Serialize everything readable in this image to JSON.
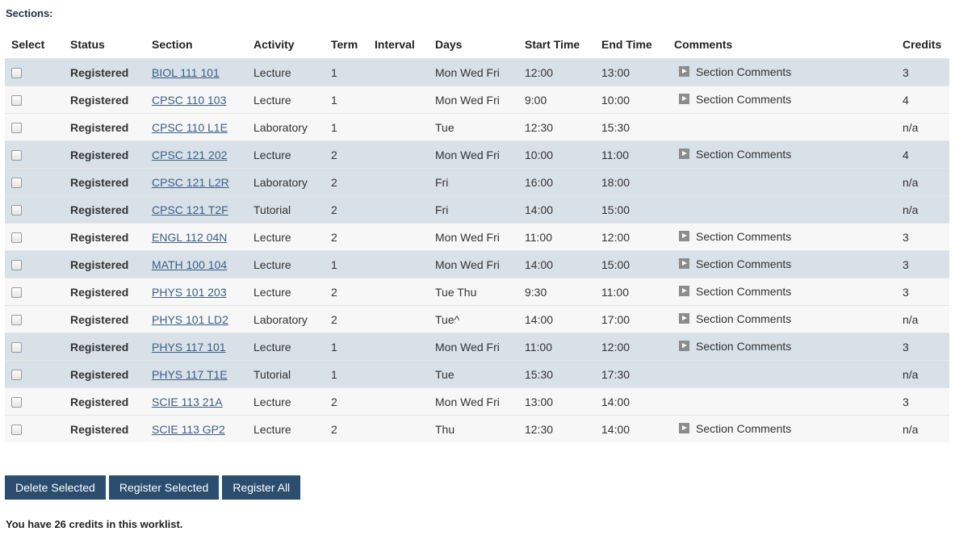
{
  "sections_label": "Sections:",
  "columns": [
    "Select",
    "Status",
    "Section",
    "Activity",
    "Term",
    "Interval",
    "Days",
    "Start Time",
    "End Time",
    "Comments",
    "Credits"
  ],
  "rows": [
    {
      "status": "Registered",
      "section": "BIOL 111 101",
      "activity": "Lecture",
      "term": "1",
      "interval": "",
      "days": "Mon Wed Fri",
      "start": "12:00",
      "end": "13:00",
      "comments": "Section Comments",
      "credits": "3",
      "shade": "shaded"
    },
    {
      "status": "Registered",
      "section": "CPSC 110 103",
      "activity": "Lecture",
      "term": "1",
      "interval": "",
      "days": "Mon Wed Fri",
      "start": "9:00",
      "end": "10:00",
      "comments": "Section Comments",
      "credits": "4",
      "shade": "plain"
    },
    {
      "status": "Registered",
      "section": "CPSC 110 L1E",
      "activity": "Laboratory",
      "term": "1",
      "interval": "",
      "days": "Tue",
      "start": "12:30",
      "end": "15:30",
      "comments": "",
      "credits": "n/a",
      "shade": "plain"
    },
    {
      "status": "Registered",
      "section": "CPSC 121 202",
      "activity": "Lecture",
      "term": "2",
      "interval": "",
      "days": "Mon Wed Fri",
      "start": "10:00",
      "end": "11:00",
      "comments": "Section Comments",
      "credits": "4",
      "shade": "shaded"
    },
    {
      "status": "Registered",
      "section": "CPSC 121 L2R",
      "activity": "Laboratory",
      "term": "2",
      "interval": "",
      "days": "Fri",
      "start": "16:00",
      "end": "18:00",
      "comments": "",
      "credits": "n/a",
      "shade": "shaded"
    },
    {
      "status": "Registered",
      "section": "CPSC 121 T2F",
      "activity": "Tutorial",
      "term": "2",
      "interval": "",
      "days": "Fri",
      "start": "14:00",
      "end": "15:00",
      "comments": "",
      "credits": "n/a",
      "shade": "shaded"
    },
    {
      "status": "Registered",
      "section": "ENGL 112 04N",
      "activity": "Lecture",
      "term": "2",
      "interval": "",
      "days": "Mon Wed Fri",
      "start": "11:00",
      "end": "12:00",
      "comments": "Section Comments",
      "credits": "3",
      "shade": "plain"
    },
    {
      "status": "Registered",
      "section": "MATH 100 104",
      "activity": "Lecture",
      "term": "1",
      "interval": "",
      "days": "Mon Wed Fri",
      "start": "14:00",
      "end": "15:00",
      "comments": "Section Comments",
      "credits": "3",
      "shade": "shaded"
    },
    {
      "status": "Registered",
      "section": "PHYS 101 203",
      "activity": "Lecture",
      "term": "2",
      "interval": "",
      "days": "Tue Thu",
      "start": "9:30",
      "end": "11:00",
      "comments": "Section Comments",
      "credits": "3",
      "shade": "plain"
    },
    {
      "status": "Registered",
      "section": "PHYS 101 LD2",
      "activity": "Laboratory",
      "term": "2",
      "interval": "",
      "days": "Tue^",
      "start": "14:00",
      "end": "17:00",
      "comments": "Section Comments",
      "credits": "n/a",
      "shade": "plain"
    },
    {
      "status": "Registered",
      "section": "PHYS 117 101",
      "activity": "Lecture",
      "term": "1",
      "interval": "",
      "days": "Mon Wed Fri",
      "start": "11:00",
      "end": "12:00",
      "comments": "Section Comments",
      "credits": "3",
      "shade": "shaded"
    },
    {
      "status": "Registered",
      "section": "PHYS 117 T1E",
      "activity": "Tutorial",
      "term": "1",
      "interval": "",
      "days": "Tue",
      "start": "15:30",
      "end": "17:30",
      "comments": "",
      "credits": "n/a",
      "shade": "shaded"
    },
    {
      "status": "Registered",
      "section": "SCIE 113 21A",
      "activity": "Lecture",
      "term": "2",
      "interval": "",
      "days": "Mon Wed Fri",
      "start": "13:00",
      "end": "14:00",
      "comments": "",
      "credits": "3",
      "shade": "plain"
    },
    {
      "status": "Registered",
      "section": "SCIE 113 GP2",
      "activity": "Lecture",
      "term": "2",
      "interval": "",
      "days": "Thu",
      "start": "12:30",
      "end": "14:00",
      "comments": "Section Comments",
      "credits": "n/a",
      "shade": "plain"
    }
  ],
  "buttons": {
    "delete": "Delete Selected",
    "register_selected": "Register Selected",
    "register_all": "Register All"
  },
  "credits_note": "You have 26 credits in this worklist.",
  "colors": {
    "button_bg": "#2b4d6e",
    "row_shaded": "#d8e0e8",
    "row_plain": "#f7f7f7",
    "link": "#3b5f86"
  }
}
